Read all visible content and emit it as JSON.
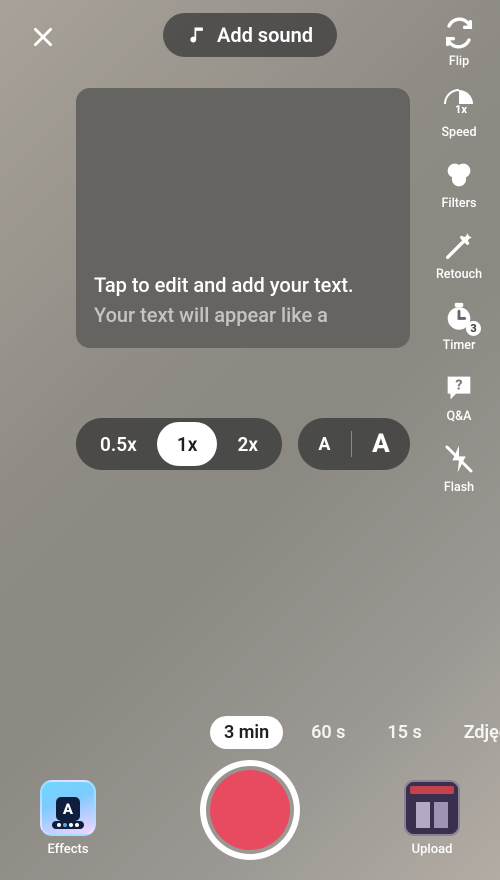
{
  "top": {
    "add_sound_label": "Add sound"
  },
  "tools": {
    "flip": "Flip",
    "speed": "Speed",
    "filters": "Filters",
    "retouch": "Retouch",
    "timer": "Timer",
    "timer_badge": "3",
    "qa": "Q&A",
    "flash": "Flash"
  },
  "speed_options": {
    "opt_0": "0.5x",
    "opt_1": "1x",
    "opt_2": "2x",
    "speed_icon_text": "1x"
  },
  "font_options": {
    "small": "A",
    "large": "A"
  },
  "teleprompter": {
    "line1": "Tap to edit and add your text.",
    "line2": "Your text will appear like a"
  },
  "durations": {
    "d0": "3 min",
    "d1": "60 s",
    "d2": "15 s",
    "d3": "Zdjęc"
  },
  "bottom": {
    "effects_label": "Effects",
    "effects_icon_letter": "A",
    "upload_label": "Upload"
  }
}
